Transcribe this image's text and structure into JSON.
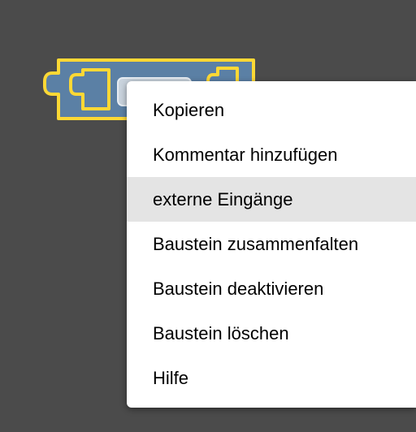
{
  "workspace": {
    "background": "#4b4b4b"
  },
  "block": {
    "fill": "#5b80a5",
    "stroke": "#fdd835",
    "field_fill": "#c9d3dd"
  },
  "context_menu": {
    "items": [
      {
        "label": "Kopieren",
        "highlighted": false
      },
      {
        "label": "Kommentar hinzufügen",
        "highlighted": false
      },
      {
        "label": "externe Eingänge",
        "highlighted": true
      },
      {
        "label": "Baustein zusammenfalten",
        "highlighted": false
      },
      {
        "label": "Baustein deaktivieren",
        "highlighted": false
      },
      {
        "label": "Baustein löschen",
        "highlighted": false
      },
      {
        "label": "Hilfe",
        "highlighted": false
      }
    ],
    "highlight_color": "#e4e4e4"
  }
}
